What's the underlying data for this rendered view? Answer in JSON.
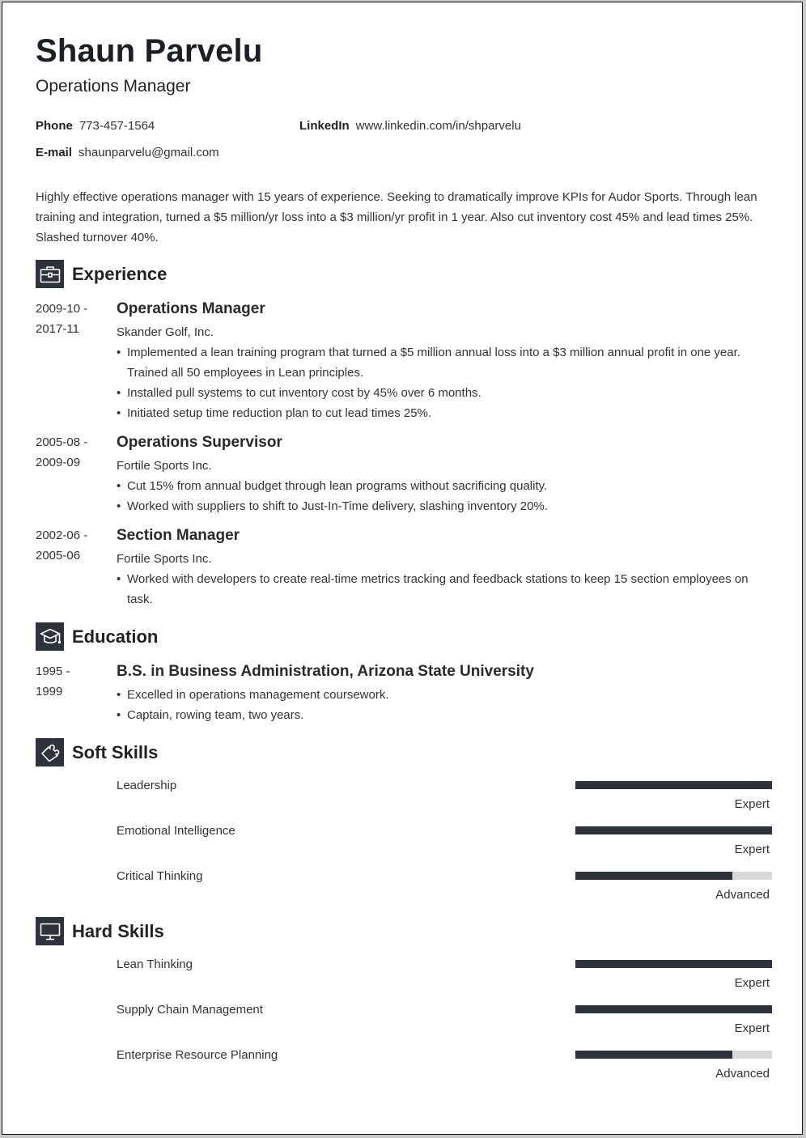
{
  "header": {
    "name": "Shaun Parvelu",
    "title": "Operations Manager"
  },
  "contact": {
    "phone_label": "Phone",
    "phone": "773-457-1564",
    "linkedin_label": "LinkedIn",
    "linkedin": "www.linkedin.com/in/shparvelu",
    "email_label": "E-mail",
    "email": "shaunparvelu@gmail.com"
  },
  "summary": "Highly effective operations manager with 15 years of experience. Seeking to dramatically improve KPIs for Audor Sports. Through lean training and integration, turned a $5 million/yr loss into a $3 million/yr profit in 1 year. Also cut inventory cost 45% and lead times 25%. Slashed turnover 40%.",
  "sections": {
    "experience": {
      "title": "Experience",
      "icon": "briefcase-icon"
    },
    "education": {
      "title": "Education",
      "icon": "graduation-cap-icon"
    },
    "soft_skills": {
      "title": "Soft Skills",
      "icon": "puzzle-piece-icon"
    },
    "hard_skills": {
      "title": "Hard Skills",
      "icon": "monitor-icon"
    }
  },
  "experience": [
    {
      "date_start": "2009-10 -",
      "date_end": "2017-11",
      "title": "Operations Manager",
      "company": "Skander Golf, Inc.",
      "bullets": [
        "Implemented a lean training program that turned a $5 million annual loss into a $3 million annual profit in one year. Trained all 50 employees in Lean principles.",
        "Installed pull systems to cut inventory cost by 45% over 6 months.",
        "Initiated setup time reduction plan to cut lead times 25%."
      ]
    },
    {
      "date_start": "2005-08 -",
      "date_end": "2009-09",
      "title": "Operations Supervisor",
      "company": "Fortile Sports Inc.",
      "bullets": [
        "Cut 15% from annual budget through lean programs without sacrificing quality.",
        "Worked with suppliers to shift to Just-In-Time delivery, slashing inventory 20%."
      ]
    },
    {
      "date_start": "2002-06 -",
      "date_end": "2005-06",
      "title": "Section Manager",
      "company": "Fortile Sports Inc.",
      "bullets": [
        "Worked with developers to create real-time metrics tracking and feedback stations to keep 15 section employees on task."
      ]
    }
  ],
  "education": [
    {
      "date_start": "1995 -",
      "date_end": "1999",
      "title": "B.S. in Business Administration, Arizona State University",
      "bullets": [
        "Excelled in operations management coursework.",
        "Captain, rowing team, two years."
      ]
    }
  ],
  "soft_skills": [
    {
      "name": "Leadership",
      "level": "Expert",
      "proficiency": 1.0
    },
    {
      "name": "Emotional Intelligence",
      "level": "Expert",
      "proficiency": 1.0
    },
    {
      "name": "Critical Thinking",
      "level": "Advanced",
      "proficiency": 0.8
    }
  ],
  "hard_skills": [
    {
      "name": "Lean Thinking",
      "level": "Expert",
      "proficiency": 1.0
    },
    {
      "name": "Supply Chain Management",
      "level": "Expert",
      "proficiency": 1.0
    },
    {
      "name": "Enterprise Resource Planning",
      "level": "Advanced",
      "proficiency": 0.8
    }
  ],
  "colors": {
    "accent": "#2d323d",
    "bar_track": "#d8d8d8"
  }
}
